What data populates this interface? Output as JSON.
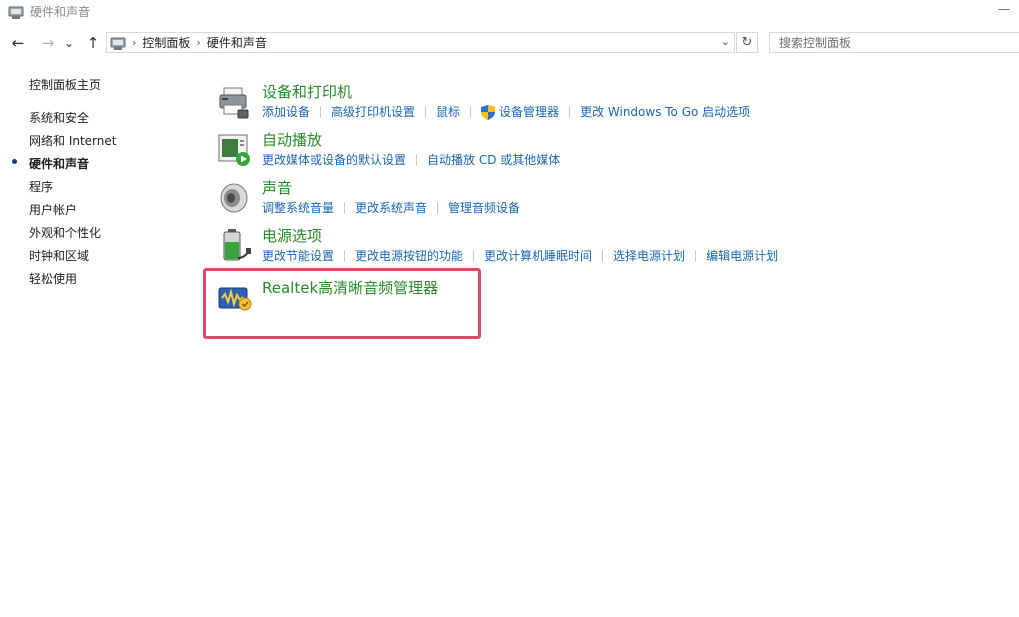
{
  "window": {
    "title": "硬件和声音",
    "minimize_glyph": "—"
  },
  "navigation": {
    "back_glyph": "←",
    "forward_glyph": "→",
    "recent_glyph": "⌄",
    "up_glyph": "↑",
    "breadcrumb": [
      "控制面板",
      "硬件和声音"
    ],
    "breadcrumb_separator": "›",
    "dropdown_glyph": "⌄",
    "refresh_glyph": "↻"
  },
  "search": {
    "placeholder": "搜索控制面板"
  },
  "sidebar": {
    "items": [
      {
        "label": "控制面板主页",
        "active": false
      },
      {
        "label": "系统和安全",
        "active": false
      },
      {
        "label": "网络和 Internet",
        "active": false
      },
      {
        "label": "硬件和声音",
        "active": true
      },
      {
        "label": "程序",
        "active": false
      },
      {
        "label": "用户帐户",
        "active": false
      },
      {
        "label": "外观和个性化",
        "active": false
      },
      {
        "label": "时钟和区域",
        "active": false
      },
      {
        "label": "轻松使用",
        "active": false
      }
    ]
  },
  "categories": [
    {
      "title": "设备和打印机",
      "icon": "printer-icon",
      "links": [
        "添加设备",
        "高级打印机设置",
        "鼠标",
        "设备管理器",
        "更改 Windows To Go 启动选项"
      ]
    },
    {
      "title": "自动播放",
      "icon": "autoplay-icon",
      "links": [
        "更改媒体或设备的默认设置",
        "自动播放 CD 或其他媒体"
      ]
    },
    {
      "title": "声音",
      "icon": "speaker-icon",
      "links": [
        "调整系统音量",
        "更改系统声音",
        "管理音频设备"
      ]
    },
    {
      "title": "电源选项",
      "icon": "battery-icon",
      "links": [
        "更改节能设置",
        "更改电源按钮的功能",
        "更改计算机睡眠时间",
        "选择电源计划",
        "编辑电源计划"
      ]
    },
    {
      "title": "Realtek高清晰音频管理器",
      "icon": "realtek-audio-icon",
      "links": []
    }
  ],
  "colors": {
    "category_title": "#2a8a2a",
    "link": "#1a66b3",
    "highlight": "#e04a60"
  }
}
